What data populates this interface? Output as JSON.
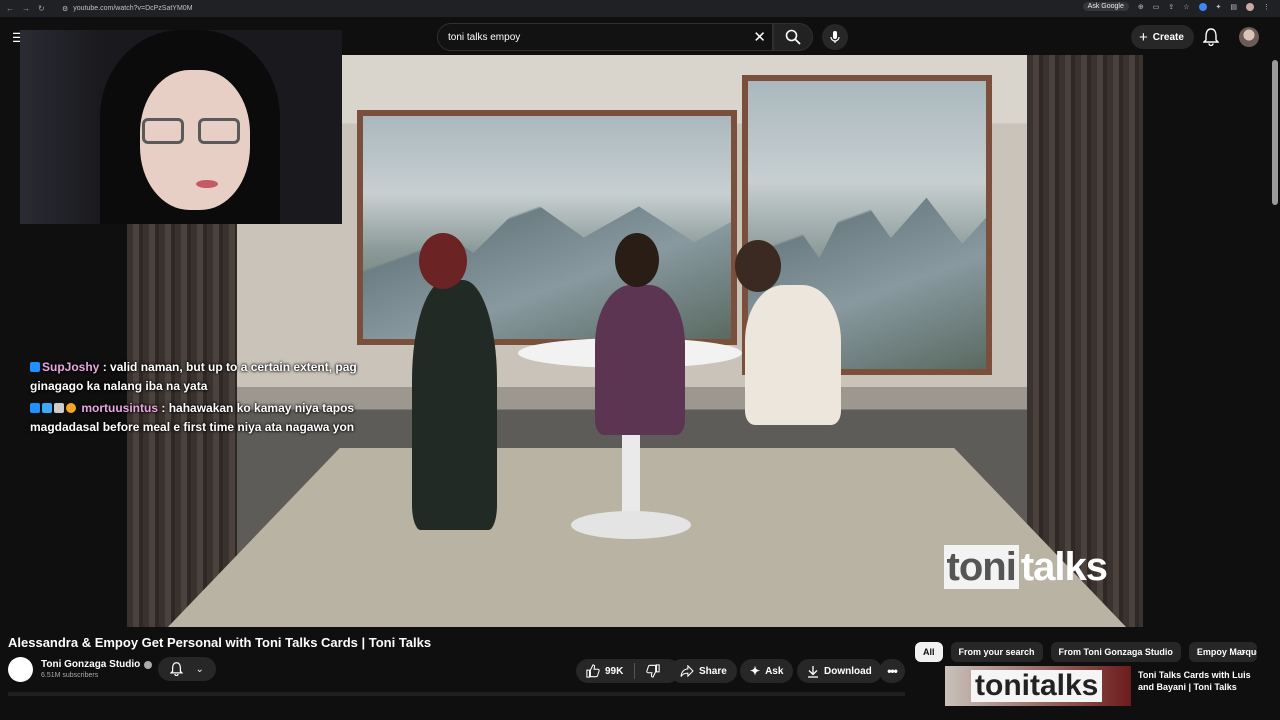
{
  "browser": {
    "url": "youtube.com/watch?v=DcPzSatYM0M",
    "ask_google": "Ask Google"
  },
  "header": {
    "search_value": "toni talks empoy",
    "create_label": "Create"
  },
  "chat": {
    "messages": [
      {
        "user": "SupJoshy",
        "text": ": valid naman, but up to a certain extent, pag ginagago ka nalang iba na yata"
      },
      {
        "user": "mortuusintus",
        "text": ": hahawakan ko kamay niya tapos magdadasal before meal e first time niya ata nagawa yon"
      }
    ]
  },
  "video": {
    "watermark_left": "toni",
    "watermark_right": "talks",
    "title": "Alessandra & Empoy Get Personal with Toni Talks Cards | Toni Talks"
  },
  "channel": {
    "name": "Toni Gonzaga Studio",
    "subscribers": "6.51M subscribers"
  },
  "actions": {
    "likes": "99K",
    "share": "Share",
    "ask": "Ask",
    "download": "Download"
  },
  "chips": [
    "All",
    "From your search",
    "From Toni Gonzaga Studio",
    "Empoy Marque"
  ],
  "recommendation": {
    "thumb_text": "tonitalks",
    "title": "Toni Talks Cards with Luis and Bayani | Toni Talks"
  }
}
